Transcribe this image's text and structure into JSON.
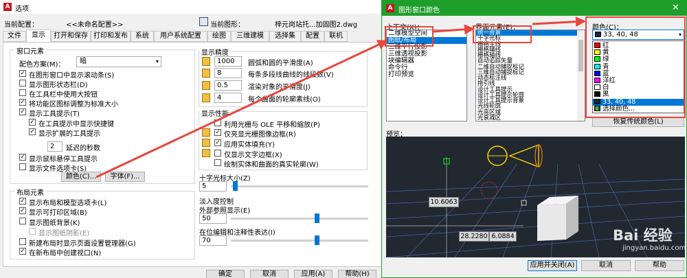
{
  "options": {
    "title": "选项",
    "profile_label": "当前配置：",
    "profile_value": "<<未命名配置>>",
    "drawing_label": "当前图形：",
    "drawing_value": "梓元岗站托...加固图2.dwg",
    "tabs": [
      "文件",
      "显示",
      "打开和保存",
      "打印和发布",
      "系统",
      "用户系统配置",
      "绘图",
      "三维建模",
      "选择集",
      "配置",
      "联机"
    ],
    "window_elements": {
      "title": "窗口元素",
      "scheme_label": "配色方案(M)：",
      "scheme_value": "暗",
      "items": [
        {
          "label": "在图形窗口中显示滚动条(S)",
          "checked": true
        },
        {
          "label": "显示图形状态栏(D)",
          "checked": false
        },
        {
          "label": "在工具栏中使用大按钮",
          "checked": false
        },
        {
          "label": "将功能区图标调整为标准大小",
          "checked": true
        },
        {
          "label": "显示工具提示(T)",
          "checked": true
        },
        {
          "label": "在工具提示中显示快捷键",
          "checked": true
        },
        {
          "label": "显示扩展的工具提示",
          "checked": true
        }
      ],
      "delay_value": "2",
      "delay_label": "延迟的秒数",
      "rollover": {
        "label": "显示鼠标悬停工具提示",
        "checked": true
      },
      "filetabs": {
        "label": "显示文件选项卡(S)",
        "checked": false
      },
      "colors_btn": "颜色(C)...",
      "fonts_btn": "字体(F)..."
    },
    "layout_elements": {
      "title": "布局元素",
      "items": [
        {
          "label": "显示布局和模型选项卡(L)",
          "checked": true
        },
        {
          "label": "显示可打印区域(B)",
          "checked": true
        },
        {
          "label": "显示图纸背景(K)",
          "checked": false
        },
        {
          "label": "显示图纸阴影(E)",
          "checked": false
        },
        {
          "label": "新建布局时显示页面设置管理器(G)",
          "checked": false
        },
        {
          "label": "在新布局中创建视口(N)",
          "checked": true
        }
      ]
    },
    "precision": {
      "title": "显示精度",
      "rows": [
        {
          "value": "1000",
          "label": "圆弧和圆的平滑度(A)"
        },
        {
          "value": "8",
          "label": "每条多段线曲线的线段数(V)"
        },
        {
          "value": "0.5",
          "label": "渲染对象的平滑度(J)"
        },
        {
          "value": "4",
          "label": "每个曲面的轮廓素线(O)"
        }
      ]
    },
    "performance": {
      "title": "显示性能",
      "items": [
        {
          "label": "利用光栅与 OLE 平移和缩放(P)",
          "checked": false
        },
        {
          "label": "仅亮显光栅图像边框(R)",
          "checked": true
        },
        {
          "label": "应用实体填充(Y)",
          "checked": true
        },
        {
          "label": "仅显示文字边框(X)",
          "checked": false
        },
        {
          "label": "绘制实体和曲面的真实轮廓(W)",
          "checked": false
        }
      ]
    },
    "crosshair": {
      "title": "十字光标大小(Z)",
      "value": "5"
    },
    "fade": {
      "title": "淡入度控制",
      "xref_label": "外部参照显示(E)",
      "xref_value": "50",
      "inplace_label": "在位编辑和注释性表达(I)",
      "inplace_value": "70"
    },
    "buttons": [
      "确定",
      "取消",
      "应用(A)",
      "帮助(H)"
    ]
  },
  "color_dialog": {
    "title": "图形窗口颜色",
    "context_label": "上下文(X)：",
    "contexts": [
      "二维模型空间",
      "图纸/布局",
      "三维平行投影",
      "三维透视投影",
      "块编辑器",
      "命令行",
      "打印预览"
    ],
    "element_label": "界面元素(E)：",
    "elements": [
      "统一背景",
      "十字光标",
      "栅格主线",
      "栅格辅线",
      "栅格轴线",
      "自动追踪矢量",
      "二维自动捕捉标记",
      "三维自动捕捉标记",
      "动态标注线",
      "拖引线",
      "设计工具提示",
      "设计工具提示轮廓",
      "设计工具提示背景",
      "光线轮廓",
      "光亮区域",
      "光衰减区"
    ],
    "color_label": "颜色(C)：",
    "color_value": "33, 40, 48",
    "colors": [
      {
        "name": "红",
        "hex": "#ff0000"
      },
      {
        "name": "黄",
        "hex": "#ffff00"
      },
      {
        "name": "绿",
        "hex": "#00ff00"
      },
      {
        "name": "青",
        "hex": "#00ffff"
      },
      {
        "name": "蓝",
        "hex": "#0000ff"
      },
      {
        "name": "洋红",
        "hex": "#ff00ff"
      },
      {
        "name": "白",
        "hex": "#ffffff"
      },
      {
        "name": "黑",
        "hex": "#000000"
      },
      {
        "name": "33, 40, 48",
        "hex": "#212830"
      },
      {
        "name": "选择颜色...",
        "hex": ""
      }
    ],
    "restore_btn": "恢复传统颜色(L)",
    "preview_label": "预览：",
    "readout1": "10.6063",
    "readout2": "28.2280",
    "readout3": "6.0884",
    "buttons": [
      "应用并关闭(A)",
      "取消",
      "帮助"
    ],
    "watermark": "Bai 经验",
    "watermark_url": "jingyan.baidu.com",
    "accent": "#0078d7",
    "titlebar": "#1e9e2a",
    "arrow": "#e8453c",
    "preview_bg": "#212830"
  }
}
